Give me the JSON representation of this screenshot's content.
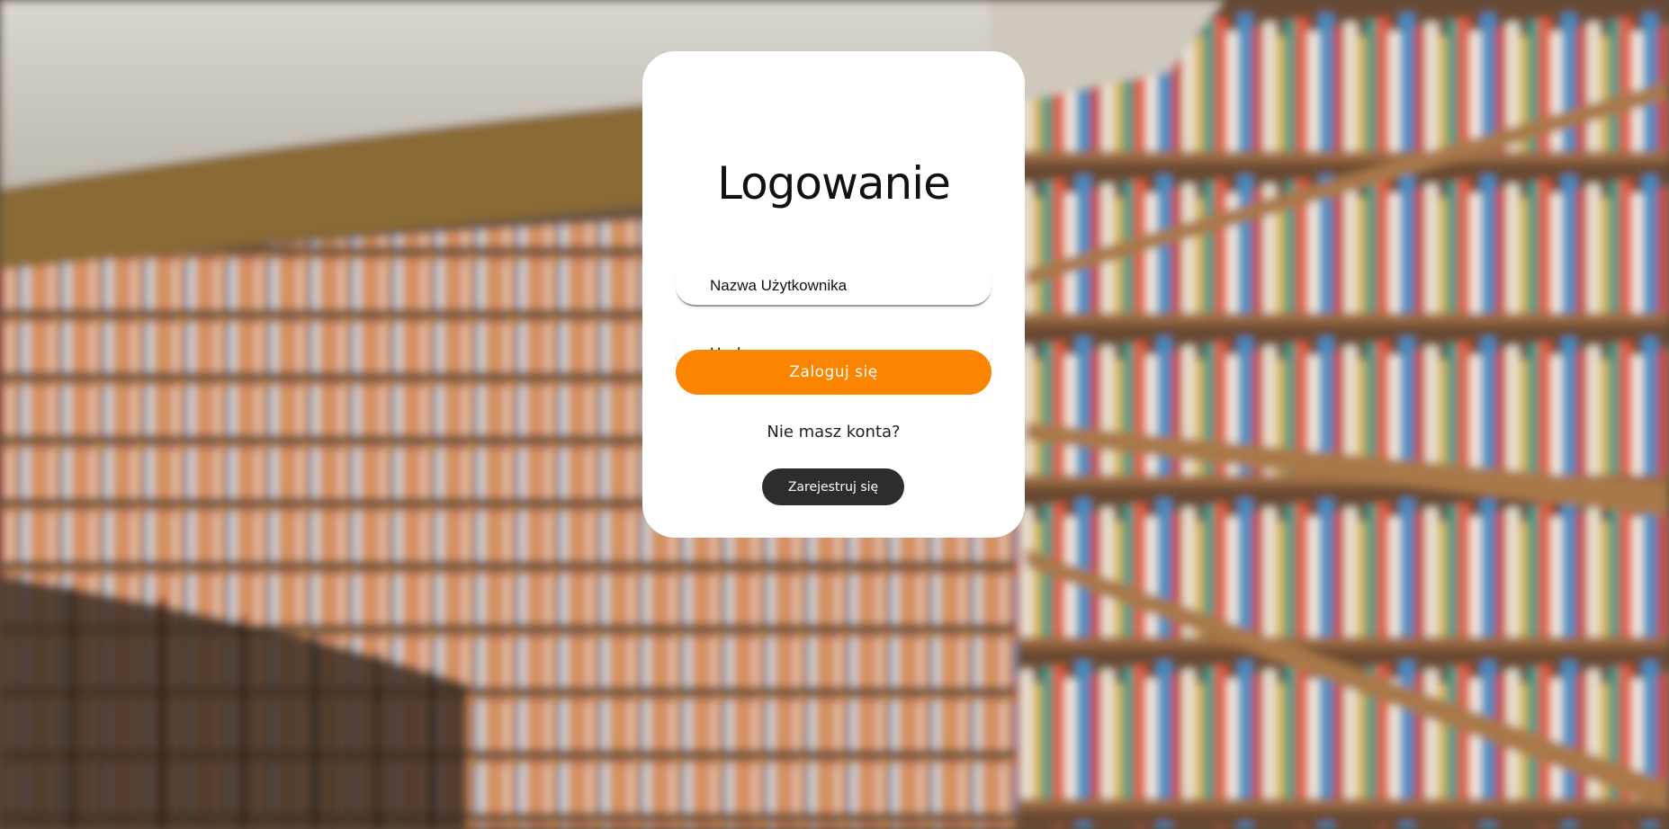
{
  "background": {
    "image": "library-bookshelves-blurred"
  },
  "login_card": {
    "title": "Logowanie",
    "username": {
      "placeholder": "Nazwa Użytkownika",
      "value": ""
    },
    "password": {
      "placeholder": "Hasło",
      "value": ""
    },
    "login_button_label": "Zaloguj się",
    "no_account_text": "Nie masz konta?",
    "register_button_label": "Zarejestruj się"
  },
  "colors": {
    "accent": "#fb8500",
    "card": "#ffffff",
    "register_button": "#2d2d2d"
  }
}
